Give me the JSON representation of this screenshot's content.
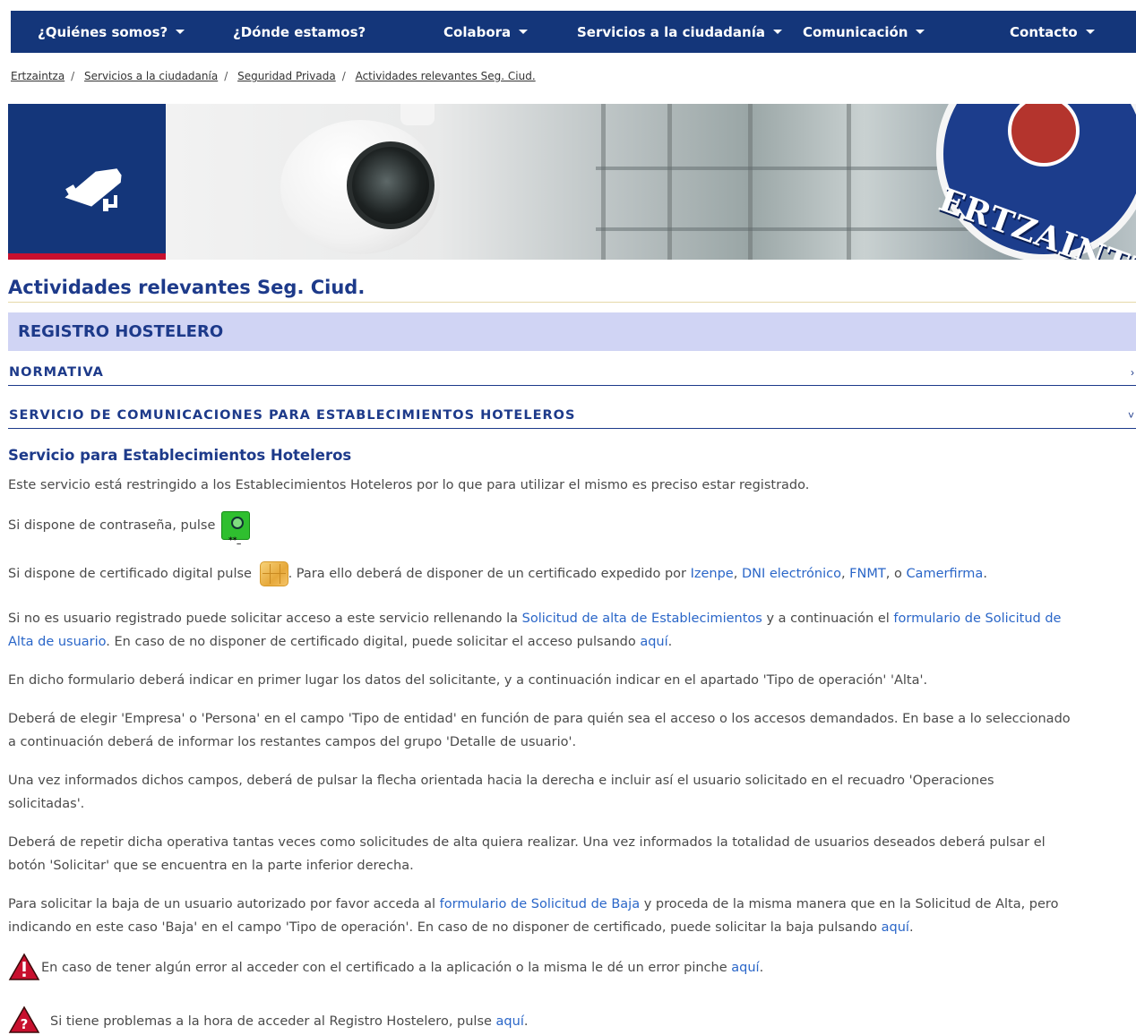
{
  "nav": {
    "items": [
      {
        "label": "¿Quiénes somos?",
        "dropdown": true
      },
      {
        "label": "¿Dónde estamos?",
        "dropdown": false
      },
      {
        "label": "Colabora",
        "dropdown": true
      },
      {
        "label": "Servicios a la ciudadanía",
        "dropdown": true
      },
      {
        "label": "Comunicación",
        "dropdown": true
      },
      {
        "label": "Contacto",
        "dropdown": true
      }
    ]
  },
  "breadcrumb": [
    "Ertzaintza",
    "Servicios a la ciudadanía",
    "Seguridad Privada",
    "Actividades relevantes Seg. Ciud."
  ],
  "banner": {
    "badge_text": "ERTZAINTZA"
  },
  "page_title": "Actividades relevantes Seg. Ciud.",
  "section_title": "REGISTRO HOSTELERO",
  "accordions": [
    {
      "label": "NORMATIVA"
    },
    {
      "label": "SERVICIO DE COMUNICACIONES PARA ESTABLECIMIENTOS HOTELEROS"
    }
  ],
  "content": {
    "subtitle": "Servicio para Establecimientos Hoteleros",
    "intro": "Este servicio está restringido a los Establecimientos Hoteleros por lo que para utilizar el mismo es preciso estar registrado.",
    "password_text": "Si dispone de contraseña, pulse",
    "cert_text_1": "Si dispone de certificado digital pulse",
    "cert_text_2": ". Para ello deberá de disponer de un certificado expedido por",
    "cert_link_izenpe": "Izenpe",
    "cert_link_dni": "DNI electrónico",
    "cert_link_fnmt": "FNMT",
    "cert_or": ", o",
    "cert_link_camerfirma": "Camerfirma",
    "reg_1": "Si no es usuario registrado puede solicitar acceso a este servicio rellenando la",
    "reg_link_alta_est": "Solicitud de alta de Establecimientos",
    "reg_2": "y a continuación el",
    "reg_link_form_a": "formulario de Solicitud de",
    "reg_link_form_b": "Alta de usuario",
    "reg_3": ". En caso de no disponer de certificado digital, puede solicitar el acceso pulsando",
    "link_aqui": "aquí",
    "form_text": "En dicho formulario deberá indicar en primer lugar los datos del solicitante, y a continuación indicar en el apartado 'Tipo de operación' 'Alta'.",
    "tipo_1": "Deberá de elegir 'Empresa' o 'Persona' en el campo 'Tipo de entidad' en función de para quién sea el acceso o los accesos demandados. En base a lo seleccionado",
    "tipo_2": "a continuación deberá de informar los restantes campos del grupo 'Detalle de usuario'.",
    "flecha_1": "Una vez informados dichos campos, deberá de pulsar la flecha orientada hacia la derecha e incluir así el usuario solicitado en el recuadro 'Operaciones",
    "flecha_2": "solicitadas'.",
    "repetir_1": "Deberá de repetir dicha operativa tantas veces como solicitudes de alta quiera realizar. Una vez informados la totalidad de usuarios deseados deberá pulsar el",
    "repetir_2": "botón 'Solicitar' que se encuentra en la parte inferior derecha.",
    "baja_1": "Para solicitar la baja de un usuario autorizado por favor acceda al",
    "baja_link": "formulario de Solicitud de Baja",
    "baja_2": "y proceda de la misma manera que en la Solicitud de Alta, pero",
    "baja_3": "indicando en este caso 'Baja' en el campo 'Tipo de operación'. En caso de no disponer de certificado, puede solicitar la baja pulsando",
    "error_text": "En caso de tener algún error al acceder con el certificado a la aplicación o la misma le dé un error pinche",
    "problem_text": "Si tiene problemas a la hora de acceder al Registro Hostelero, pulse"
  },
  "colors": {
    "nav_bg": "#14367a",
    "heading": "#1d3a8a",
    "link": "#2a66c8",
    "section_bg": "#d0d4f4",
    "accent_red": "#c8102e"
  }
}
